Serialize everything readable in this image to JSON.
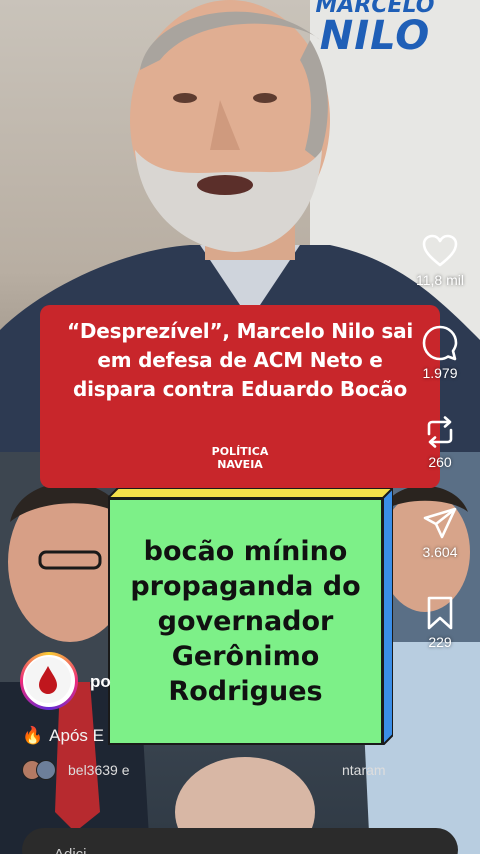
{
  "brand": {
    "line1": "MARCELO",
    "line2": "NILO"
  },
  "headline": {
    "text": "“Desprezível”, Marcelo Nilo sai em defesa de ACM Neto e dispara contra Eduardo Bocão",
    "logo_line1": "POLÍTICA",
    "logo_line2": "NAVEIA"
  },
  "sticker": {
    "text": "bocão mínino propaganda do governador Gerônimo Rodrigues"
  },
  "actions": {
    "like": {
      "icon": "heart-icon",
      "count": "11,8 mil"
    },
    "comment": {
      "icon": "comment-icon",
      "count": "1.979"
    },
    "repost": {
      "icon": "repost-icon",
      "count": "260"
    },
    "share": {
      "icon": "send-icon",
      "count": "3.604"
    },
    "save": {
      "icon": "bookmark-icon",
      "count": "229"
    }
  },
  "creator": {
    "username_partial": "po",
    "avatar_icon": "blood-drop-icon"
  },
  "caption": {
    "emoji": "🔥",
    "text_partial": "Após E"
  },
  "liked_by": {
    "name": "bel3639",
    "connector": "e",
    "tail_partial": "ntaram"
  },
  "comment_bar": {
    "placeholder_partial": "Adici"
  },
  "colors": {
    "headline_red": "#c8262b",
    "sticker_green": "#7df088",
    "brand_blue": "#1f5fb7"
  }
}
